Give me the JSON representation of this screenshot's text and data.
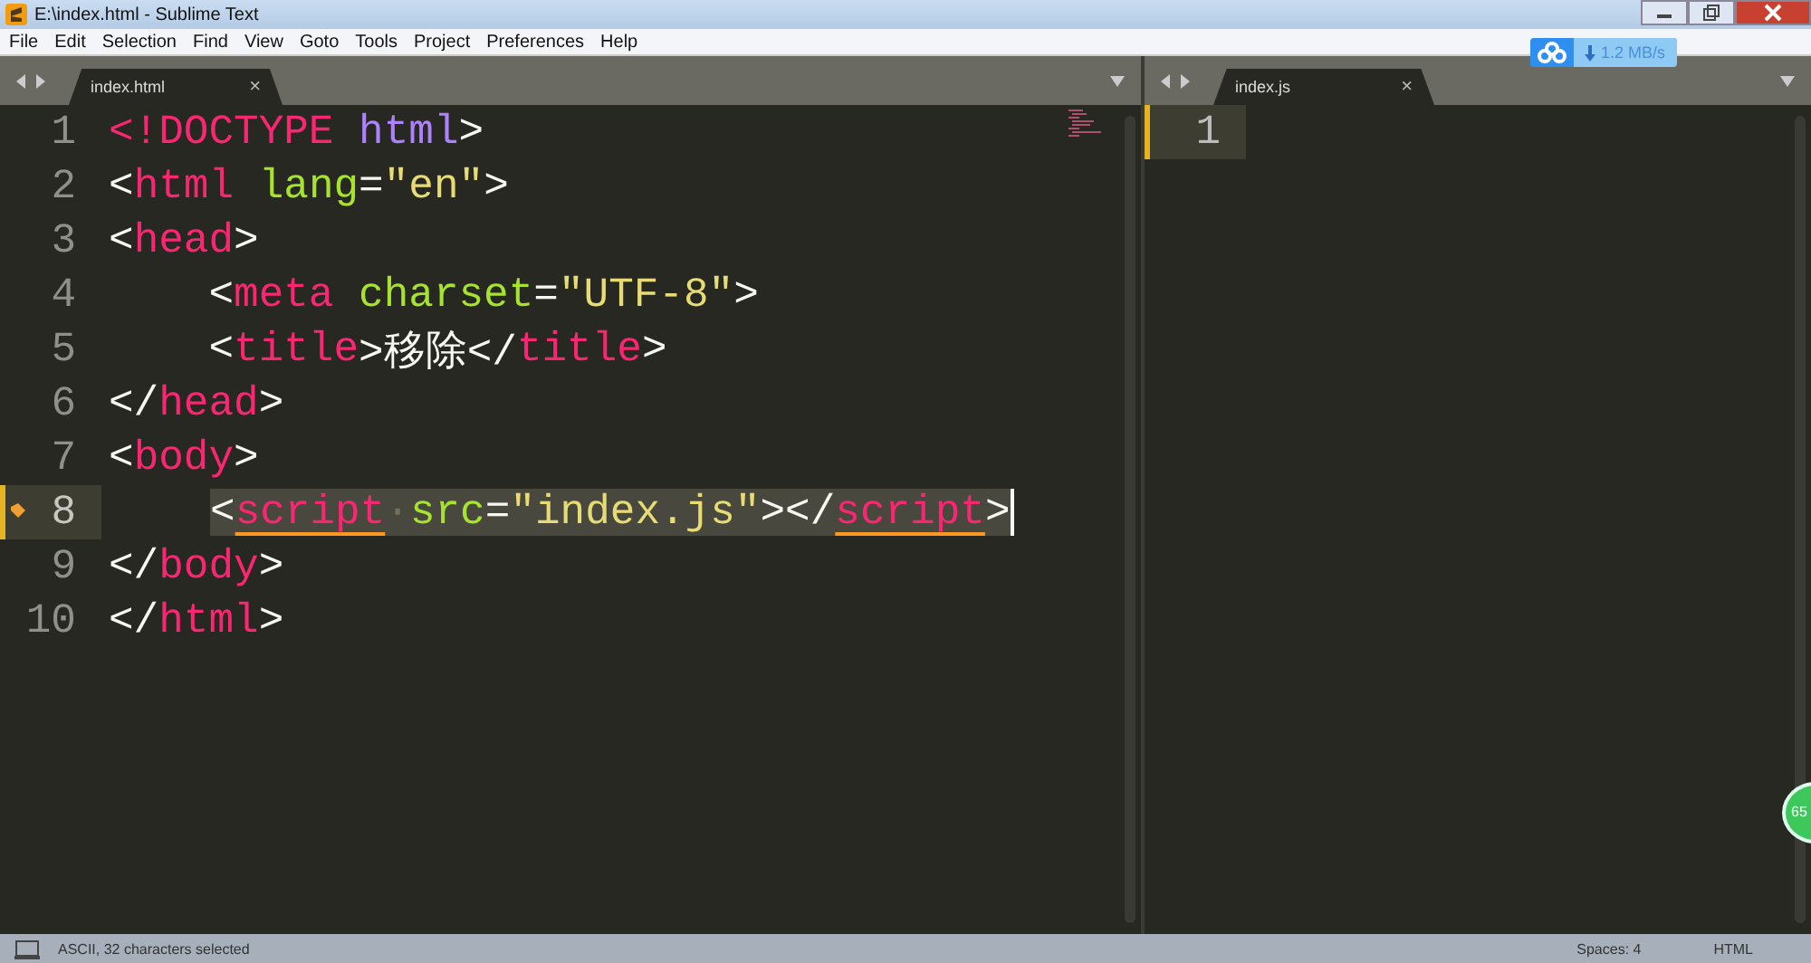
{
  "window": {
    "title": "E:\\index.html - Sublime Text"
  },
  "menu": [
    "File",
    "Edit",
    "Selection",
    "Find",
    "View",
    "Goto",
    "Tools",
    "Project",
    "Preferences",
    "Help"
  ],
  "left_pane": {
    "tab": {
      "label": "index.html",
      "close": "×",
      "selected": true
    },
    "lines": [
      {
        "number": "1",
        "selected": false,
        "tokens": [
          {
            "kind": "tag",
            "text": "<!DOCTYPE"
          },
          {
            "kind": "keyword",
            "text": " html"
          },
          {
            "kind": "punct",
            "text": ">"
          }
        ]
      },
      {
        "number": "2",
        "selected": false,
        "tokens": [
          {
            "kind": "punct",
            "text": "<"
          },
          {
            "kind": "tag",
            "text": "html"
          },
          {
            "kind": "attr",
            "text": " lang"
          },
          {
            "kind": "punct",
            "text": "="
          },
          {
            "kind": "string",
            "text": "\"en\""
          },
          {
            "kind": "punct",
            "text": ">"
          }
        ]
      },
      {
        "number": "3",
        "selected": false,
        "tokens": [
          {
            "kind": "punct",
            "text": "<"
          },
          {
            "kind": "tag",
            "text": "head"
          },
          {
            "kind": "punct",
            "text": ">"
          }
        ]
      },
      {
        "number": "4",
        "selected": false,
        "tokens": [
          {
            "kind": "punct",
            "text": "    <"
          },
          {
            "kind": "tag",
            "text": "meta"
          },
          {
            "kind": "attr",
            "text": " charset"
          },
          {
            "kind": "punct",
            "text": "="
          },
          {
            "kind": "string",
            "text": "\"UTF-8\""
          },
          {
            "kind": "punct",
            "text": ">"
          }
        ]
      },
      {
        "number": "5",
        "selected": false,
        "tokens": [
          {
            "kind": "punct",
            "text": "    <"
          },
          {
            "kind": "tag",
            "text": "title"
          },
          {
            "kind": "punct",
            "text": ">移除</"
          },
          {
            "kind": "tag",
            "text": "title"
          },
          {
            "kind": "punct",
            "text": ">"
          }
        ]
      },
      {
        "number": "6",
        "selected": false,
        "tokens": [
          {
            "kind": "punct",
            "text": "</"
          },
          {
            "kind": "tag",
            "text": "head"
          },
          {
            "kind": "punct",
            "text": ">"
          }
        ]
      },
      {
        "number": "7",
        "selected": false,
        "tokens": [
          {
            "kind": "punct",
            "text": "<"
          },
          {
            "kind": "tag",
            "text": "body"
          },
          {
            "kind": "punct",
            "text": ">"
          }
        ]
      },
      {
        "number": "8",
        "selected": true,
        "tokens": [
          {
            "kind": "punct",
            "text": "<"
          },
          {
            "kind": "tag",
            "text": "script",
            "underline": true
          },
          {
            "kind": "space",
            "text": "·"
          },
          {
            "kind": "attr",
            "text": "src"
          },
          {
            "kind": "punct",
            "text": "="
          },
          {
            "kind": "string",
            "text": "\"index.js\""
          },
          {
            "kind": "punct",
            "text": "></"
          },
          {
            "kind": "tag",
            "text": "script",
            "underline": true
          },
          {
            "kind": "punct",
            "text": ">"
          }
        ]
      },
      {
        "number": "9",
        "selected": false,
        "tokens": [
          {
            "kind": "punct",
            "text": "</"
          },
          {
            "kind": "tag",
            "text": "body"
          },
          {
            "kind": "punct",
            "text": ">"
          }
        ]
      },
      {
        "number": "10",
        "selected": false,
        "tokens": [
          {
            "kind": "punct",
            "text": "</"
          },
          {
            "kind": "tag",
            "text": "html"
          },
          {
            "kind": "punct",
            "text": ">"
          }
        ]
      }
    ]
  },
  "right_pane": {
    "tab": {
      "label": "index.js",
      "close": "×",
      "selected": true
    },
    "lines": [
      {
        "number": "1",
        "selected": true
      }
    ]
  },
  "download_widget": {
    "speed": "1.2 MB/s"
  },
  "side_badge": {
    "label": "65"
  },
  "status_bar": {
    "selection": "ASCII, 32 characters selected",
    "indent": "Spaces: 4",
    "syntax": "HTML"
  }
}
